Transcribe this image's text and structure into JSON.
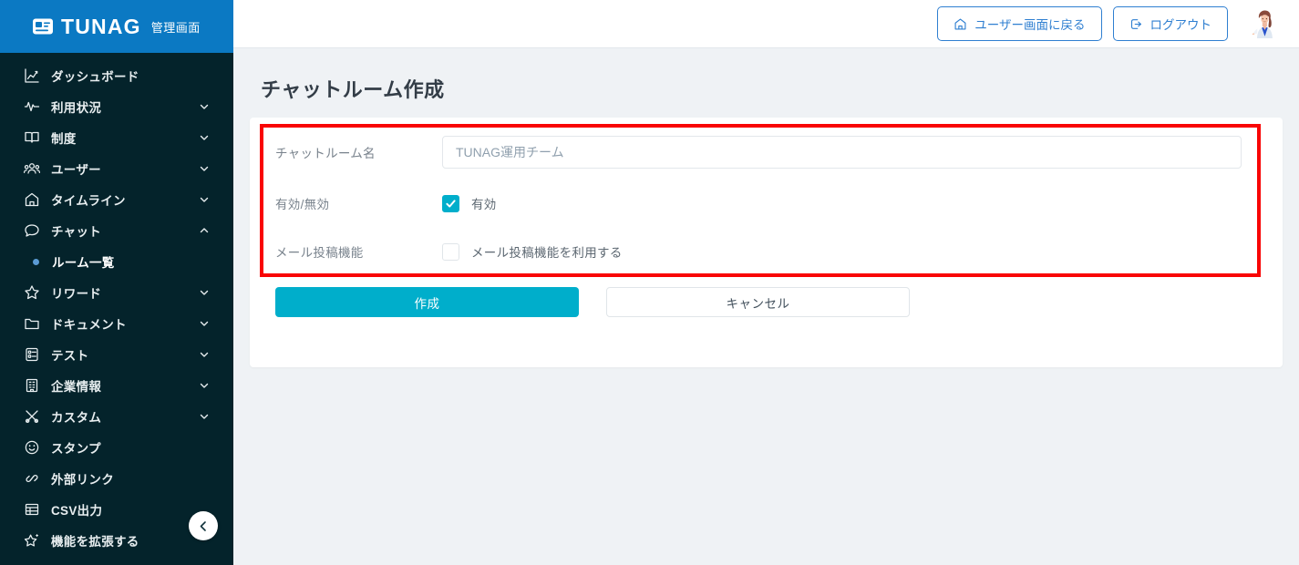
{
  "brand": {
    "logo_icon": "card-id-icon",
    "name": "TUNAG",
    "subtitle": "管理画面",
    "logo_bg": "#0b79c3",
    "sidebar_bg": "#04232b"
  },
  "sidebar": {
    "items": [
      {
        "label": "ダッシュボード",
        "icon": "chart-analytics-icon",
        "expandable": false,
        "active": false
      },
      {
        "label": "利用状況",
        "icon": "pulse-activity-icon",
        "expandable": true,
        "expanded": false
      },
      {
        "label": "制度",
        "icon": "book-open-icon",
        "expandable": true,
        "expanded": false
      },
      {
        "label": "ユーザー",
        "icon": "users-group-icon",
        "expandable": true,
        "expanded": false
      },
      {
        "label": "タイムライン",
        "icon": "home-icon",
        "expandable": true,
        "expanded": false
      },
      {
        "label": "チャット",
        "icon": "chat-bubble-icon",
        "expandable": true,
        "expanded": true
      },
      {
        "label": "リワード",
        "icon": "star-icon",
        "expandable": true,
        "expanded": false
      },
      {
        "label": "ドキュメント",
        "icon": "folder-icon",
        "expandable": true,
        "expanded": false
      },
      {
        "label": "テスト",
        "icon": "clipboard-list-icon",
        "expandable": true,
        "expanded": false
      },
      {
        "label": "企業情報",
        "icon": "building-icon",
        "expandable": true,
        "expanded": false
      },
      {
        "label": "カスタム",
        "icon": "shuffle-custom-icon",
        "expandable": true,
        "expanded": false
      },
      {
        "label": "スタンプ",
        "icon": "smiley-face-icon",
        "expandable": false
      },
      {
        "label": "外部リンク",
        "icon": "link-chain-icon",
        "expandable": false
      },
      {
        "label": "CSV出力",
        "icon": "table-grid-icon",
        "expandable": false
      },
      {
        "label": "機能を拡張する",
        "icon": "sparkle-star-icon",
        "expandable": false
      }
    ],
    "sub_item": {
      "label": "ルーム一覧",
      "parent": "チャット",
      "active": true,
      "dot_color": "#5b9bd5"
    },
    "collapse_icon": "chevron-left-icon"
  },
  "topbar": {
    "back_to_user_label": "ユーザー画面に戻る",
    "back_to_user_icon": "home-icon",
    "logout_label": "ログアウト",
    "logout_icon": "logout-arrow-icon",
    "avatar_icon": "user-avatar-illustration",
    "accent": "#2f7fd1"
  },
  "main": {
    "page_title": "チャットルーム作成",
    "highlight_color": "#f90505",
    "accent_color": "#00aecb",
    "form": {
      "room_name": {
        "label": "チャットルーム名",
        "value": "",
        "placeholder": "TUNAG運用チーム"
      },
      "enabled": {
        "label": "有効/無効",
        "checkbox_label": "有効",
        "checked": true
      },
      "mail_post": {
        "label": "メール投稿機能",
        "checkbox_label": "メール投稿機能を利用する",
        "checked": false
      }
    },
    "actions": {
      "submit_label": "作成",
      "cancel_label": "キャンセル"
    }
  }
}
